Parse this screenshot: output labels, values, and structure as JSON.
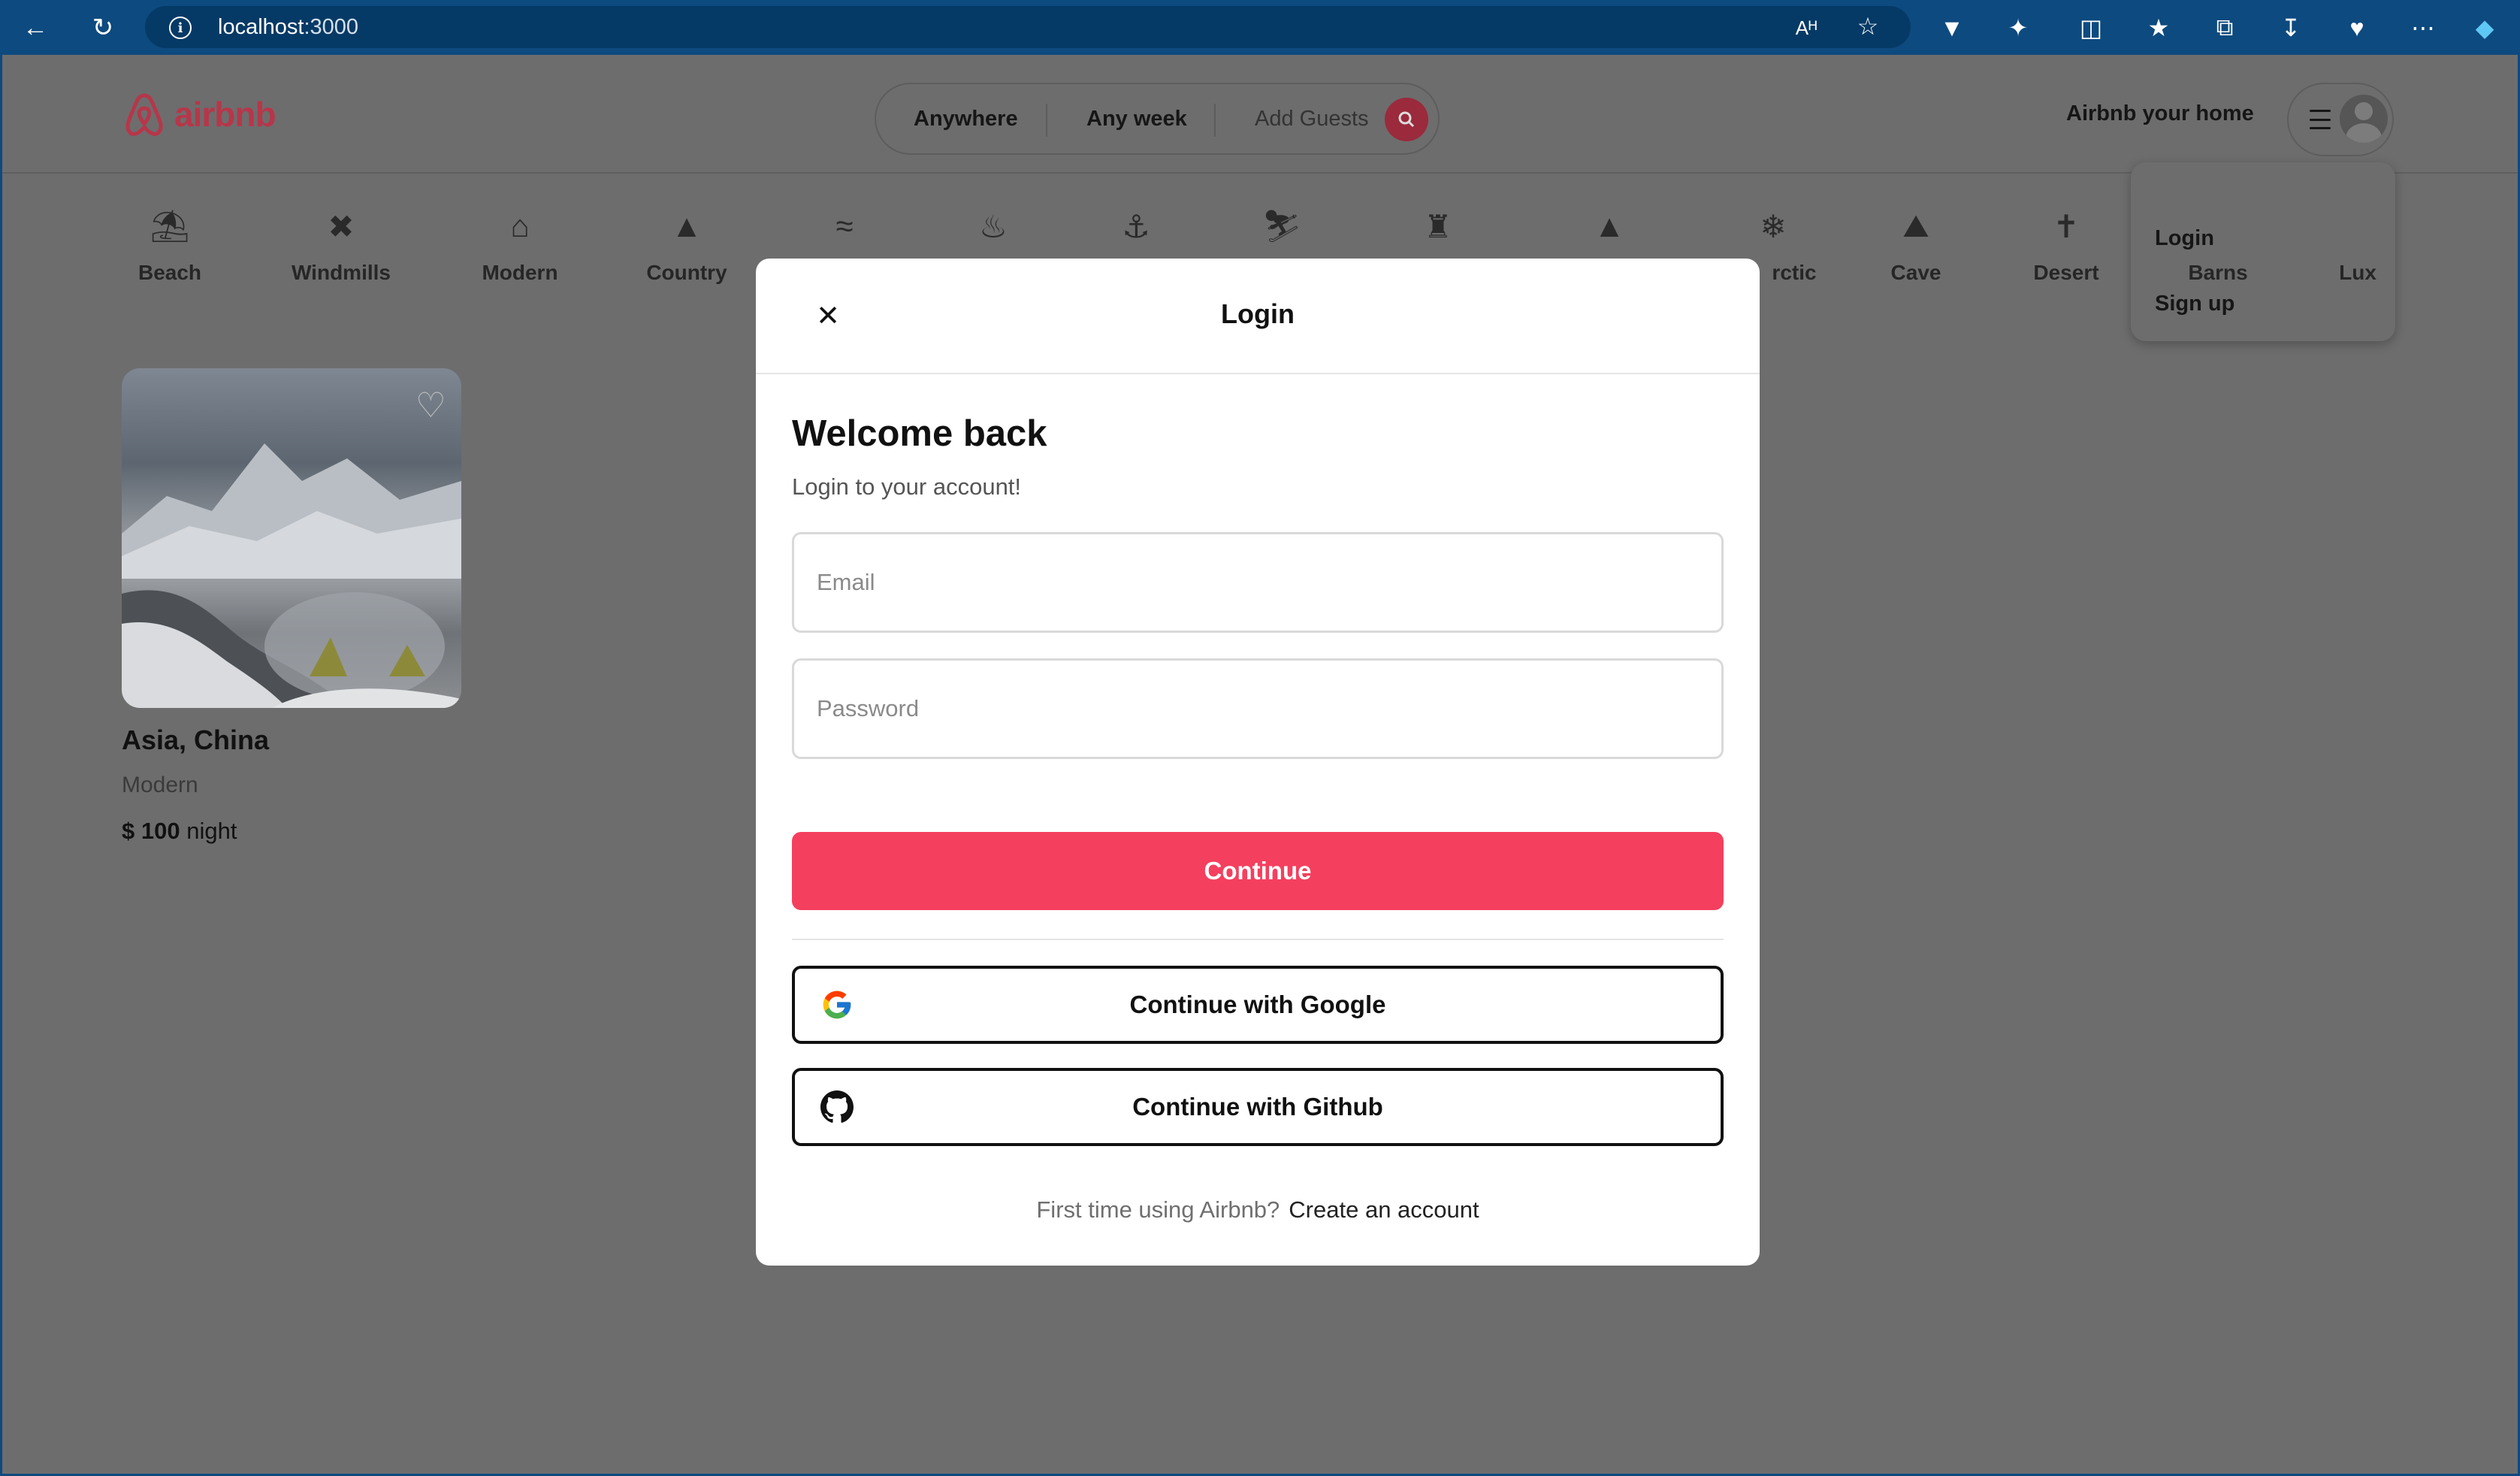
{
  "browser": {
    "url_host": "localhost",
    "url_port": ":3000"
  },
  "header": {
    "logo_text": "airbnb",
    "search": {
      "anywhere": "Anywhere",
      "any_week": "Any week",
      "add_guests": "Add Guests"
    },
    "host_link": "Airbnb your home"
  },
  "user_dropdown": {
    "items": [
      "Login",
      "Sign up"
    ]
  },
  "categories": [
    {
      "label": "Beach",
      "icon": "beach-icon"
    },
    {
      "label": "Windmills",
      "icon": "windmill-icon"
    },
    {
      "label": "Modern",
      "icon": "modern-house-icon"
    },
    {
      "label": "Country",
      "icon": "mountain-icon"
    },
    {
      "label": "",
      "icon": "pool-icon"
    },
    {
      "label": "",
      "icon": "island-icon"
    },
    {
      "label": "",
      "icon": "lake-icon"
    },
    {
      "label": "",
      "icon": "skiing-icon"
    },
    {
      "label": "",
      "icon": "castle-icon"
    },
    {
      "label": "",
      "icon": "forest-icon"
    },
    {
      "label": "rctic",
      "icon": "snowflake-icon"
    },
    {
      "label": "Cave",
      "icon": "cave-icon"
    },
    {
      "label": "Desert",
      "icon": "cactus-icon"
    },
    {
      "label": "Barns",
      "icon": "barn-icon"
    },
    {
      "label": "Lux",
      "icon": "diamond-icon"
    }
  ],
  "listing": {
    "location": "Asia, China",
    "category": "Modern",
    "price": "$ 100",
    "price_unit": "night"
  },
  "modal": {
    "title": "Login",
    "heading": "Welcome back",
    "subtitle": "Login to your account!",
    "email_placeholder": "Email",
    "password_placeholder": "Password",
    "continue_label": "Continue",
    "google_label": "Continue with Google",
    "github_label": "Continue with Github",
    "footer_prompt": "First time using Airbnb?",
    "footer_link": "Create an account"
  },
  "colors": {
    "accent": "#f43f5e",
    "browser_chrome": "#0d4a7f",
    "overlay": "#6d6d6d"
  }
}
